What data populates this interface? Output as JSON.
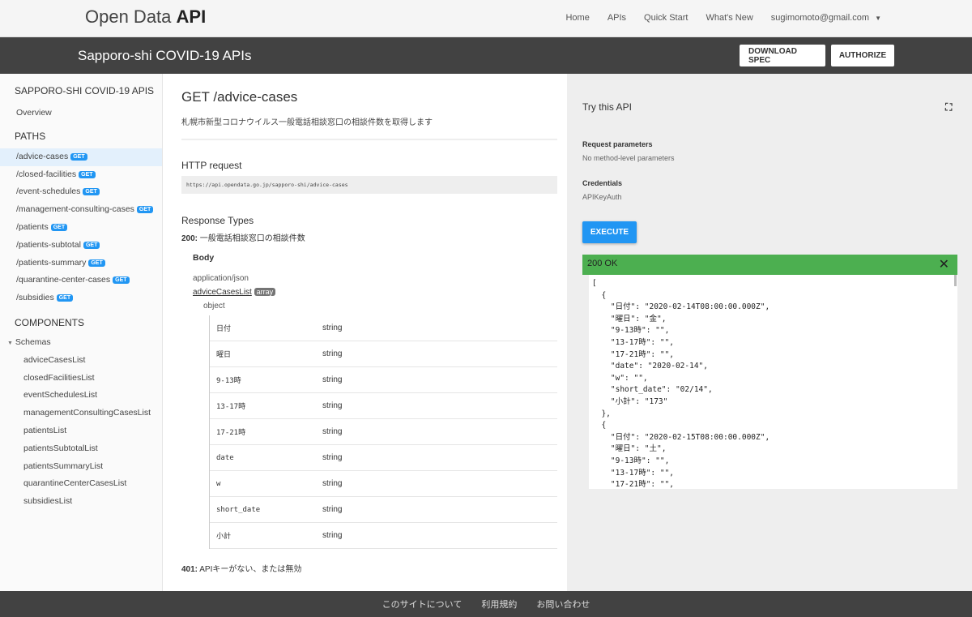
{
  "header": {
    "logo_light": "Open Data ",
    "logo_bold": "API",
    "nav": [
      "Home",
      "APIs",
      "Quick Start",
      "What's New"
    ],
    "user": "sugimomoto@gmail.com"
  },
  "bar": {
    "title": "Sapporo-shi COVID-19 APIs",
    "download": "DOWNLOAD SPEC",
    "authorize": "AUTHORIZE"
  },
  "sidebar": {
    "heading": "SAPPORO-SHI COVID-19 APIS",
    "overview": "Overview",
    "paths_heading": "PATHS",
    "badge": "GET",
    "paths": [
      "/advice-cases",
      "/closed-facilities",
      "/event-schedules",
      "/management-consulting-cases",
      "/patients",
      "/patients-subtotal",
      "/patients-summary",
      "/quarantine-center-cases",
      "/subsidies"
    ],
    "components_heading": "COMPONENTS",
    "schemas_label": "Schemas",
    "schemas": [
      "adviceCasesList",
      "closedFacilitiesList",
      "eventSchedulesList",
      "managementConsultingCasesList",
      "patientsList",
      "patientsSubtotalList",
      "patientsSummaryList",
      "quarantineCenterCasesList",
      "subsidiesList"
    ]
  },
  "main": {
    "title": "GET /advice-cases",
    "description": "札幌市新型コロナウイルス一般電話相談窓口の相談件数を取得します",
    "http_heading": "HTTP request",
    "url": "https://api.opendata.go.jp/sapporo-shi/advice-cases",
    "response_heading": "Response Types",
    "r200_code": "200:",
    "r200_text": "一般電話相談窓口の相談件数",
    "body_label": "Body",
    "content_type": "application/json",
    "schema_link": "adviceCasesList",
    "array_badge": "array",
    "object_label": "object",
    "fields": [
      [
        "日付",
        "string"
      ],
      [
        "曜日",
        "string"
      ],
      [
        "9-13時",
        "string"
      ],
      [
        "13-17時",
        "string"
      ],
      [
        "17-21時",
        "string"
      ],
      [
        "date",
        "string"
      ],
      [
        "w",
        "string"
      ],
      [
        "short_date",
        "string"
      ],
      [
        "小計",
        "string"
      ]
    ],
    "r401_code": "401:",
    "r401_text": "APIキーがない、または無効"
  },
  "try": {
    "title": "Try this API",
    "params_label": "Request parameters",
    "params_value": "No method-level parameters",
    "cred_label": "Credentials",
    "cred_value": "APIKeyAuth",
    "execute": "EXECUTE",
    "status": "200 OK",
    "response": "[\n  {\n    \"日付\": \"2020-02-14T08:00:00.000Z\",\n    \"曜日\": \"金\",\n    \"9-13時\": \"\",\n    \"13-17時\": \"\",\n    \"17-21時\": \"\",\n    \"date\": \"2020-02-14\",\n    \"w\": \"\",\n    \"short_date\": \"02/14\",\n    \"小計\": \"173\"\n  },\n  {\n    \"日付\": \"2020-02-15T08:00:00.000Z\",\n    \"曜日\": \"土\",\n    \"9-13時\": \"\",\n    \"13-17時\": \"\",\n    \"17-21時\": \"\","
  },
  "footer": [
    "このサイトについて",
    "利用規約",
    "お問い合わせ"
  ],
  "colors": {
    "accent": "#2196f3",
    "success": "#4caf50",
    "dark": "#424242"
  }
}
